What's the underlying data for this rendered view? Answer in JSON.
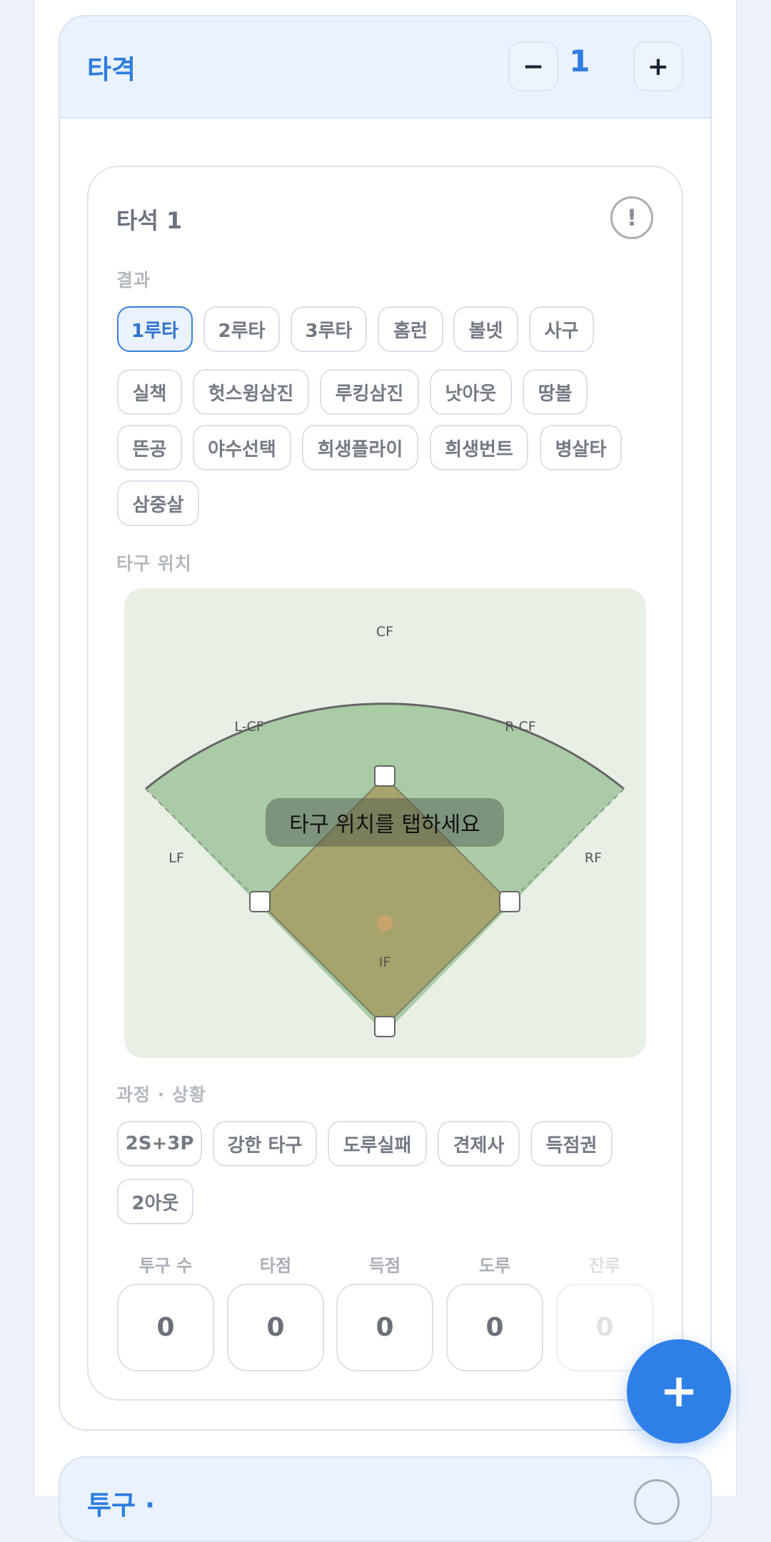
{
  "section": {
    "title": "타격",
    "minus_label": "−",
    "count": "1",
    "plus_label": "+"
  },
  "plate_appearance": {
    "title": "타석 1",
    "alert_label": "!"
  },
  "result": {
    "label": "결과",
    "selected": "1루타",
    "options": [
      "1루타",
      "2루타",
      "3루타",
      "홈런",
      "볼넷",
      "사구",
      "실책",
      "헛스윙삼진",
      "루킹삼진",
      "낫아웃",
      "땅볼",
      "뜬공",
      "야수선택",
      "희생플라이",
      "희생번트",
      "병살타",
      "삼중살"
    ]
  },
  "hit_location": {
    "label": "타구 위치",
    "zones": {
      "cf": "CF",
      "lcf": "L-CF",
      "rcf": "R-CF",
      "lf": "LF",
      "rf": "RF",
      "if": "IF"
    },
    "hint": "타구 위치를 탭하세요",
    "colors": {
      "field_bg": "#e8efe5",
      "outfield": "#a9cba6",
      "infield": "#a6a46c"
    }
  },
  "situation": {
    "label": "과정 · 상황",
    "options": [
      "2S+3P",
      "강한 타구",
      "도루실패",
      "견제사",
      "득점권",
      "2아웃"
    ]
  },
  "stats": [
    {
      "label": "투구 수",
      "value": "0"
    },
    {
      "label": "타점",
      "value": "0"
    },
    {
      "label": "득점",
      "value": "0"
    },
    {
      "label": "도루",
      "value": "0"
    },
    {
      "label": "잔루",
      "value": "0"
    }
  ],
  "fab": {
    "label": "+"
  },
  "next_section": {
    "title": "투구 ·"
  },
  "colors": {
    "accent": "#2f7de0",
    "fab": "#2f7fe9"
  }
}
